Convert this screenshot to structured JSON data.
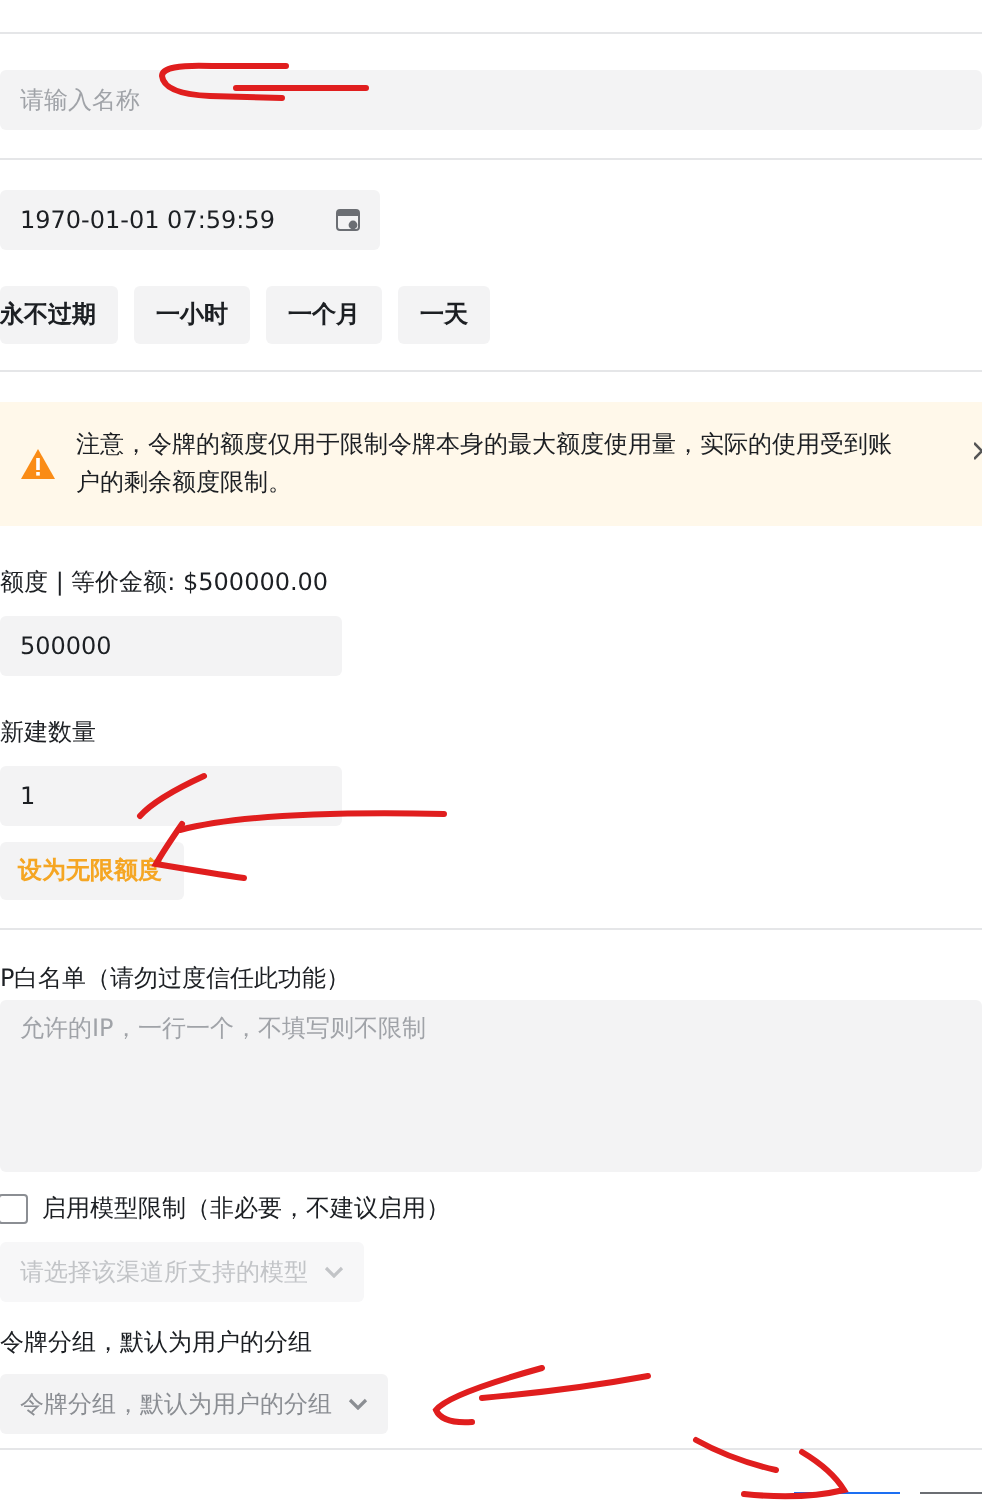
{
  "name_field": {
    "placeholder": "请输入名称"
  },
  "expiry": {
    "value": "1970-01-01 07:59:59",
    "quick_options": [
      "永不过期",
      "一小时",
      "一个月",
      "一天"
    ]
  },
  "notice": {
    "text": "注意，令牌的额度仅用于限制令牌本身的最大额度使用量，实际的使用受到账户的剩余额度限制。"
  },
  "quota": {
    "label": "额度 | 等价金额: $500000.00",
    "value": "500000"
  },
  "count": {
    "label": "新建数量",
    "value": "1"
  },
  "unlimited_button": "设为无限额度",
  "ip_whitelist": {
    "label": "P白名单（请勿过度信任此功能）",
    "placeholder": "允许的IP，一行一个，不填写则不限制"
  },
  "model_limit": {
    "label": "启用模型限制（非必要，不建议启用）",
    "checked": false,
    "placeholder": "请选择该渠道所支持的模型",
    "disabled": true
  },
  "group": {
    "label": "令牌分组，默认为用户的分组",
    "placeholder": "令牌分组，默认为用户的分组"
  }
}
